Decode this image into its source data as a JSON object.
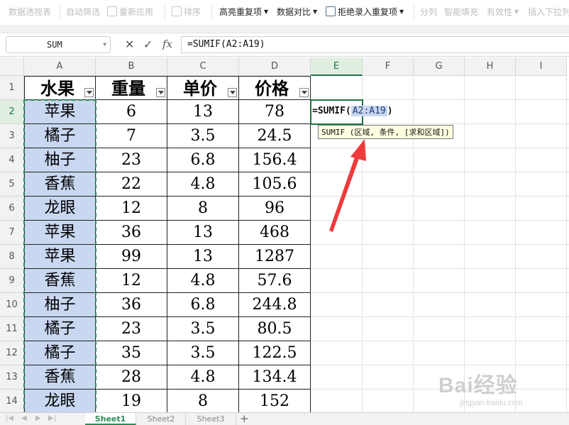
{
  "ribbon": {
    "items": [
      {
        "label": "数据透视表",
        "enabled": false
      },
      {
        "label": "自动筛选",
        "enabled": false
      },
      {
        "label": "重新应用",
        "enabled": false
      },
      {
        "label": "排序",
        "enabled": false
      },
      {
        "label": "高亮重复项",
        "enabled": true
      },
      {
        "label": "数据对比",
        "enabled": true
      },
      {
        "label": "拒绝录入重复项",
        "enabled": true
      },
      {
        "label": "分列",
        "enabled": false
      },
      {
        "label": "智能填充",
        "enabled": false
      },
      {
        "label": "有效性",
        "enabled": false
      },
      {
        "label": "插入下拉列",
        "enabled": false
      }
    ]
  },
  "formula_bar": {
    "name_box": "SUM",
    "cancel_glyph": "✕",
    "enter_glyph": "✓",
    "fx_glyph": "fx",
    "formula": "=SUMIF(A2:A19)"
  },
  "sheet": {
    "columns": [
      "A",
      "B",
      "C",
      "D",
      "E",
      "F",
      "G",
      "H",
      "I"
    ],
    "active_column": "E",
    "row_numbers": [
      "1",
      "2",
      "3",
      "4",
      "5",
      "6",
      "7",
      "8",
      "9",
      "10",
      "11",
      "12",
      "13",
      "14"
    ],
    "active_row": "2",
    "header_row": [
      "水果",
      "重量",
      "单价",
      "价格"
    ],
    "rows": [
      [
        "苹果",
        "6",
        "13",
        "78"
      ],
      [
        "橘子",
        "7",
        "3.5",
        "24.5"
      ],
      [
        "柚子",
        "23",
        "6.8",
        "156.4"
      ],
      [
        "香蕉",
        "22",
        "4.8",
        "105.6"
      ],
      [
        "龙眼",
        "12",
        "8",
        "96"
      ],
      [
        "苹果",
        "36",
        "13",
        "468"
      ],
      [
        "苹果",
        "99",
        "13",
        "1287"
      ],
      [
        "香蕉",
        "12",
        "4.8",
        "57.6"
      ],
      [
        "柚子",
        "36",
        "6.8",
        "244.8"
      ],
      [
        "橘子",
        "23",
        "3.5",
        "80.5"
      ],
      [
        "橘子",
        "35",
        "3.5",
        "122.5"
      ],
      [
        "香蕉",
        "28",
        "4.8",
        "134.4"
      ],
      [
        "龙眼",
        "19",
        "8",
        "152"
      ]
    ],
    "editing_cell": {
      "prefix": "=SUMIF(",
      "ref": "A2:A19",
      "suffix": ")"
    },
    "tooltip": "SUMIF (区域, 条件, [求和区域])"
  },
  "tabs": {
    "sheets": [
      "Sheet1",
      "Sheet2",
      "Sheet3"
    ],
    "active": "Sheet1",
    "add_glyph": "+"
  },
  "watermark": {
    "brand": "Bai经验",
    "url": "jingyan.baidu.com"
  },
  "colors": {
    "accent_green": "#217346",
    "selection_blue": "#c9d7f1",
    "annotation_red": "#ee3b3b"
  }
}
